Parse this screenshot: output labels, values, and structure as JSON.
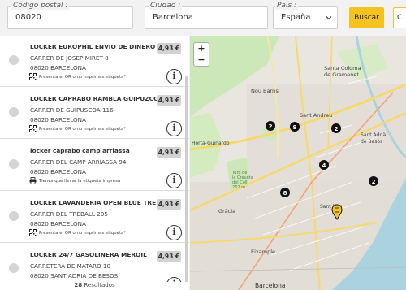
{
  "search": {
    "postal_label": "Código postal :",
    "postal_value": "08020",
    "city_label": "Ciudad :",
    "city_value": "Barcelona",
    "country_label": "País :",
    "country_value": "España",
    "search_button": "Buscar",
    "edge_button": "C"
  },
  "lockers": [
    {
      "name": "LOCKER EUROPHIL ENVIO DE DINERO",
      "street": "CARRER DE JOSEP MIRET 8",
      "city": "08020 BARCELONA",
      "price": "4,93 €",
      "note": "Presenta el QR o no imprimas etiqueta*",
      "note_icon": "qr-code-icon"
    },
    {
      "name": "LOCKER CAPRABO RAMBLA GUIPUZCOA",
      "street": "CARRER DE GUIPUSCOA 116",
      "city": "08020 BARCELONA",
      "price": "4,93 €",
      "note": "Presenta el QR o no imprimas etiqueta*",
      "note_icon": "qr-code-icon"
    },
    {
      "name": "locker caprabo camp arriassa",
      "street": "CARRER DEL CAMP ARRIASSA 94",
      "city": "08020 BARCELONA",
      "price": "4,93 €",
      "note": "Tienes que llevar la etiqueta impresa",
      "note_icon": "printer-icon"
    },
    {
      "name": "LOCKER LAVANDERIA OPEN BLUE TRE",
      "street": "CARRER DEL TREBALL 205",
      "city": "08020 BARCELONA",
      "price": "4,93 €",
      "note": "Presenta el QR o no imprimas etiqueta*",
      "note_icon": "qr-code-icon"
    },
    {
      "name": "LOCKER 24/7 GASOLINERA MEROIL",
      "street": "CARRETERA DE MATARO 10",
      "city": "08020 SANT ADRIA DE BESOS",
      "price": "4,93 €",
      "note": "",
      "note_icon": ""
    }
  ],
  "results": {
    "count": "28",
    "label": "Resultados"
  },
  "map": {
    "zoom_in": "+",
    "zoom_out": "−",
    "labels": [
      "Santa Coloma",
      "de Gramenet",
      "Nou Barris",
      "Sant Andreu",
      "Sant Adrià",
      "de Besòs",
      "Horta-Guinardó",
      "Gràcia",
      "Sant Mar",
      "Eixample",
      "Barcelona",
      "Turó de",
      "la Creueta",
      "del Coll",
      "262 m"
    ],
    "clusters": [
      "2",
      "9",
      "2",
      "4",
      "8",
      "2"
    ],
    "colors": {
      "water": "#aad3df",
      "park": "#cde8b8",
      "road": "#f7d96b",
      "urban": "#e0dcd5",
      "cluster": "#111111",
      "pin": "#f5c320"
    }
  },
  "colors": {
    "accent": "#f5c320",
    "price_bg": "#d2d2d2",
    "radio": "#d4d4d4"
  }
}
